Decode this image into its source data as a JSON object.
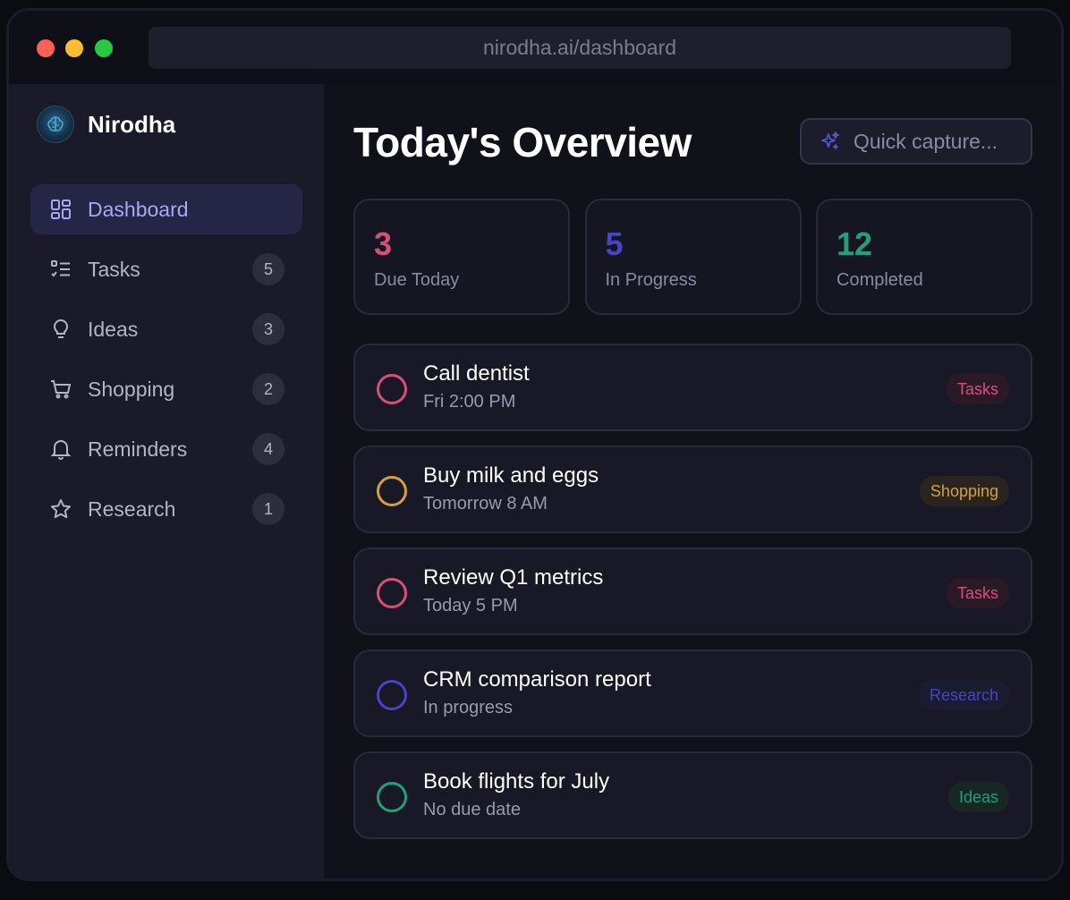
{
  "browser": {
    "url": "nirodha.ai/dashboard"
  },
  "sidebar": {
    "brand": "Nirodha",
    "items": [
      {
        "label": "Dashboard",
        "icon": "dashboard-icon",
        "count": ""
      },
      {
        "label": "Tasks",
        "icon": "checklist-icon",
        "count": "5"
      },
      {
        "label": "Ideas",
        "icon": "lightbulb-icon",
        "count": "3"
      },
      {
        "label": "Shopping",
        "icon": "cart-icon",
        "count": "2"
      },
      {
        "label": "Reminders",
        "icon": "bell-icon",
        "count": "4"
      },
      {
        "label": "Research",
        "icon": "star-icon",
        "count": "1"
      }
    ]
  },
  "main": {
    "title": "Today's Overview",
    "quick_capture": "Quick capture...",
    "stats": [
      {
        "value": "3",
        "label": "Due Today",
        "color": "#d94f7c"
      },
      {
        "value": "5",
        "label": "In Progress",
        "color": "#4a42c9"
      },
      {
        "value": "12",
        "label": "Completed",
        "color": "#22a07a"
      }
    ],
    "tasks": [
      {
        "title": "Call dentist",
        "sub": "Fri 2:00 PM",
        "tag": "Tasks",
        "color": "#d94f7c"
      },
      {
        "title": "Buy milk and eggs",
        "sub": "Tomorrow 8 AM",
        "tag": "Shopping",
        "color": "#d4a13a"
      },
      {
        "title": "Review Q1 metrics",
        "sub": "Today 5 PM",
        "tag": "Tasks",
        "color": "#d94f7c"
      },
      {
        "title": "CRM comparison report",
        "sub": "In progress",
        "tag": "Research",
        "color": "#4a42c9"
      },
      {
        "title": "Book flights for July",
        "sub": "No due date",
        "tag": "Ideas",
        "color": "#22a07a"
      }
    ]
  }
}
